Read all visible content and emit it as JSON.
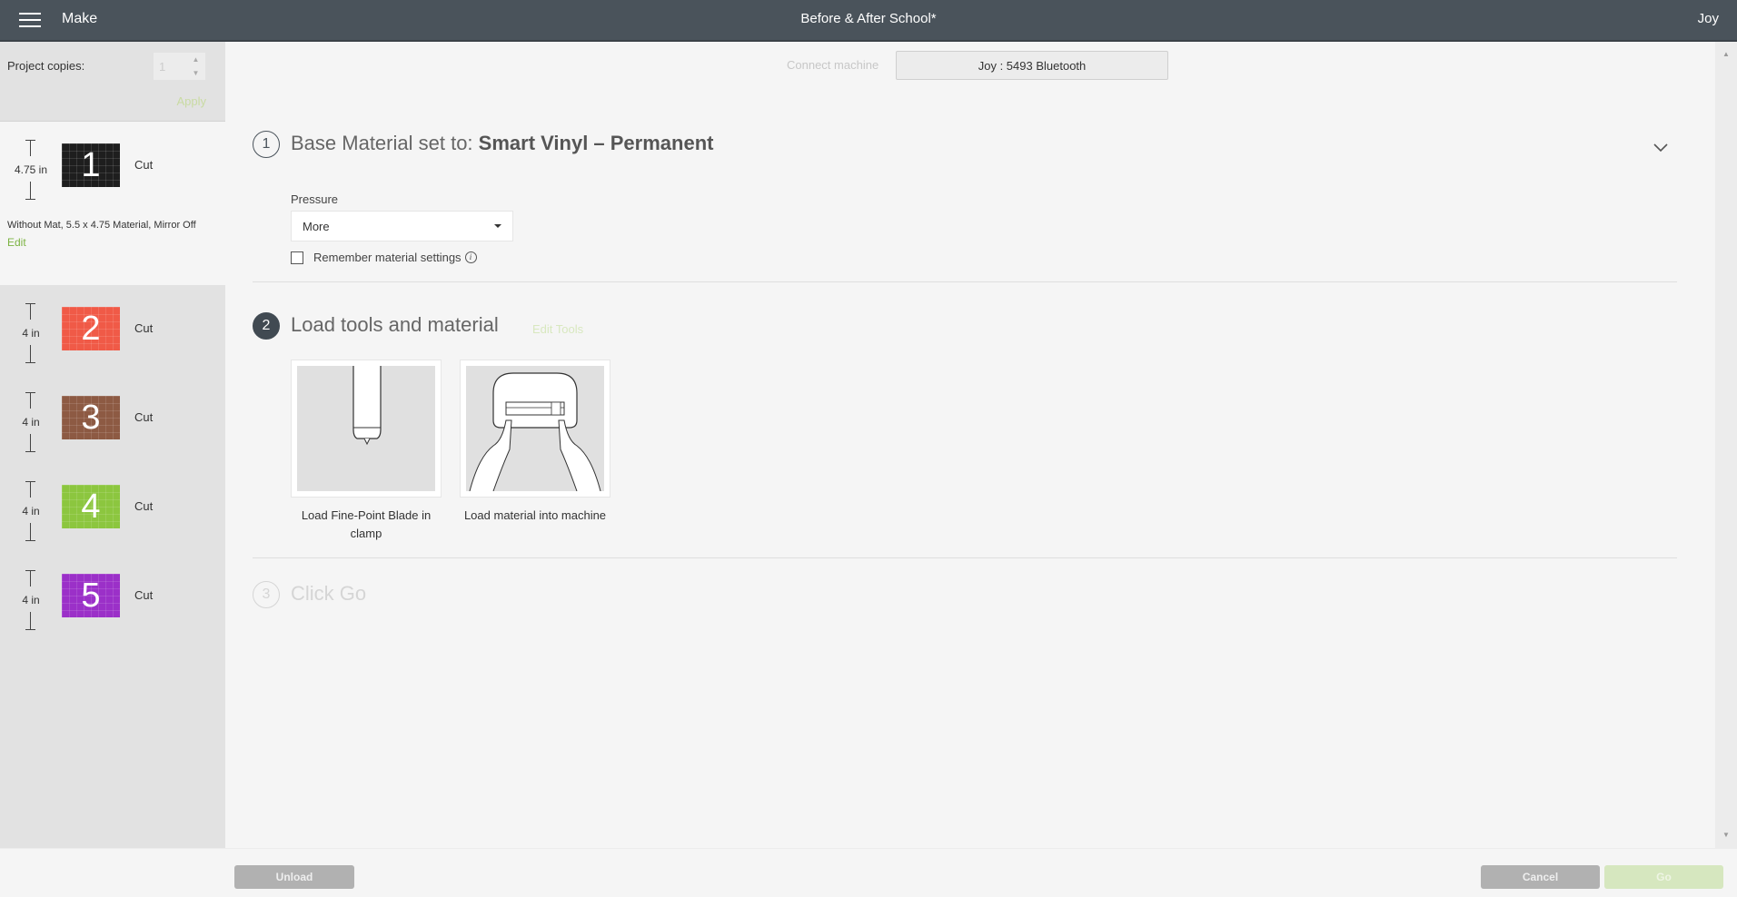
{
  "header": {
    "menu_icon": "hamburger-icon",
    "section": "Make",
    "title": "Before & After School*",
    "user": "Joy"
  },
  "sidebar": {
    "copies_label": "Project copies:",
    "copies_value": "1",
    "apply_label": "Apply",
    "mats": [
      {
        "number": "1",
        "height": "4.75 in",
        "action": "Cut",
        "color": "#1e1e1e",
        "info": "Without Mat, 5.5 x 4.75 Material, Mirror Off",
        "edit_label": "Edit",
        "selected": true
      },
      {
        "number": "2",
        "height": "4 in",
        "action": "Cut",
        "color": "#f05a47",
        "selected": false
      },
      {
        "number": "3",
        "height": "4 in",
        "action": "Cut",
        "color": "#8d5a43",
        "selected": false
      },
      {
        "number": "4",
        "height": "4 in",
        "action": "Cut",
        "color": "#8cc63f",
        "selected": false
      },
      {
        "number": "5",
        "height": "4 in",
        "action": "Cut",
        "color": "#9b30c8",
        "selected": false
      }
    ]
  },
  "connect": {
    "label": "Connect machine",
    "machine": "Joy : 5493 Bluetooth"
  },
  "steps": [
    {
      "number": "1",
      "title_prefix": "Base Material set to: ",
      "title_bold": "Smart Vinyl – Permanent",
      "pressure_label": "Pressure",
      "pressure_value": "More",
      "remember_label": "Remember material settings",
      "remember_checked": false,
      "info_icon": "i"
    },
    {
      "number": "2",
      "title": "Load tools and material",
      "edit_tools_label": "Edit Tools",
      "cards": [
        {
          "caption": "Load Fine-Point Blade in clamp",
          "icon": "fine-point-blade-icon"
        },
        {
          "caption": "Load material into machine",
          "icon": "load-material-icon"
        }
      ]
    },
    {
      "number": "3",
      "title": "Click Go"
    }
  ],
  "footer": {
    "unload_label": "Unload",
    "cancel_label": "Cancel",
    "go_label": "Go"
  },
  "colors": {
    "header_bg": "#4a535b",
    "accent_green": "#7cb342",
    "go_disabled": "#d6e7bf"
  }
}
